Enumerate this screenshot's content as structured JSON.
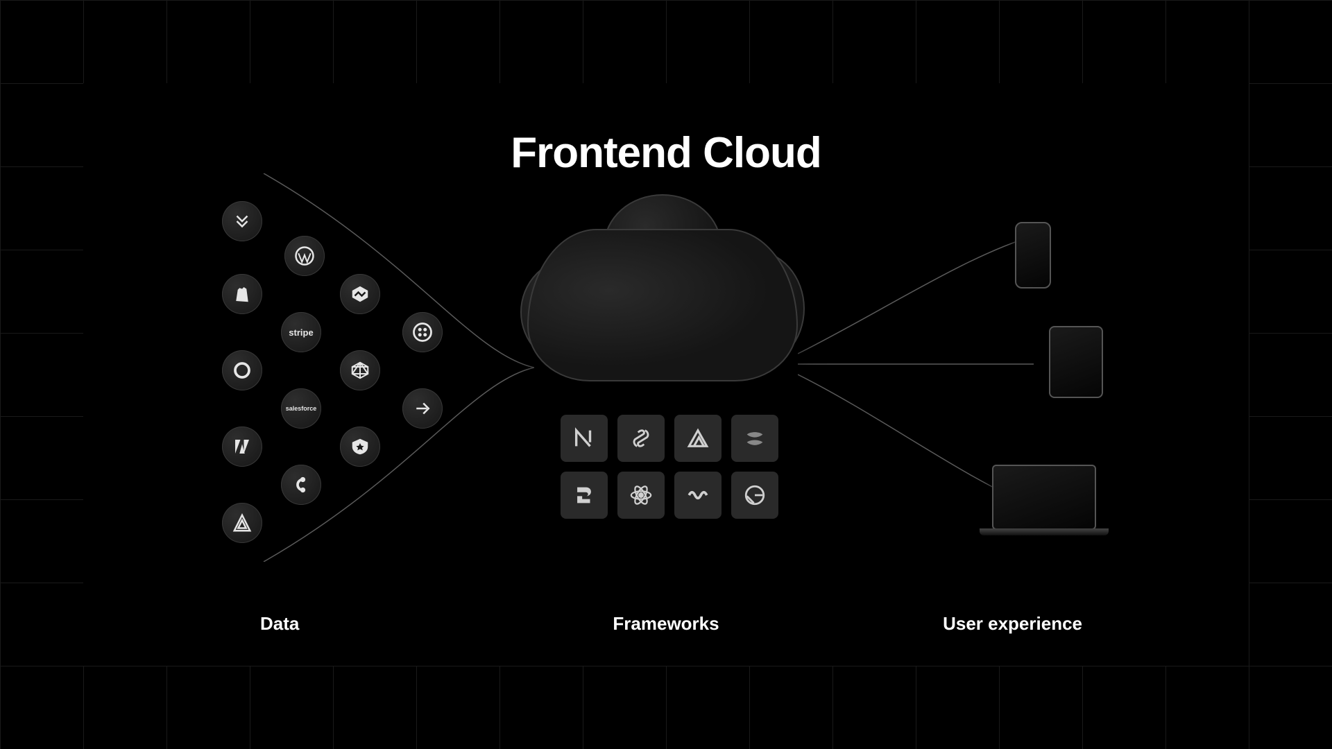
{
  "title": "Frontend Cloud",
  "columns": {
    "data": "Data",
    "frameworks": "Frameworks",
    "ux": "User experience"
  },
  "data_sources": [
    {
      "name": "hygraph",
      "label": "Hygraph"
    },
    {
      "name": "wordpress",
      "label": "WordPress"
    },
    {
      "name": "shopify",
      "label": "Shopify"
    },
    {
      "name": "hexagon",
      "label": "Datasource"
    },
    {
      "name": "stripe",
      "label": "stripe"
    },
    {
      "name": "twilio",
      "label": "Twilio"
    },
    {
      "name": "sanity",
      "label": "Sanity"
    },
    {
      "name": "graphql",
      "label": "GraphQL"
    },
    {
      "name": "salesforce",
      "label": "salesforce"
    },
    {
      "name": "arrow",
      "label": "Integration"
    },
    {
      "name": "adobe",
      "label": "Adobe"
    },
    {
      "name": "auth0",
      "label": "Auth0"
    },
    {
      "name": "contentful",
      "label": "Contentful"
    },
    {
      "name": "sentry",
      "label": "Sentry"
    }
  ],
  "frameworks": [
    {
      "name": "nextjs",
      "label": "Next.js"
    },
    {
      "name": "svelte",
      "label": "Svelte"
    },
    {
      "name": "nuxt",
      "label": "Nuxt"
    },
    {
      "name": "solid",
      "label": "SolidJS"
    },
    {
      "name": "remix",
      "label": "Remix"
    },
    {
      "name": "react",
      "label": "React"
    },
    {
      "name": "swr",
      "label": "SWR"
    },
    {
      "name": "gatsby",
      "label": "Gatsby"
    }
  ],
  "devices": [
    {
      "name": "phone",
      "label": "Smartphone"
    },
    {
      "name": "tablet",
      "label": "Tablet"
    },
    {
      "name": "laptop",
      "label": "Laptop"
    }
  ]
}
